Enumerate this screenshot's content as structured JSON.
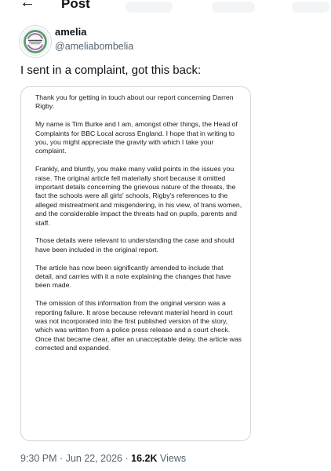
{
  "header": {
    "back_icon": "back-arrow-icon",
    "title": "Post"
  },
  "author": {
    "display_name": "amelia",
    "handle": "@ameliabombelia",
    "avatar_icon": "badge-logo-icon"
  },
  "tweet": {
    "text": "I sent in a complaint, got this back:"
  },
  "letter": {
    "paragraphs": [
      "Thank you for getting in touch about our report concerning Darren Rigby.",
      "My name is Tim Burke and I am, amongst other things, the Head of Complaints for BBC Local across England. I hope that in writing to you, you might appreciate the gravity with which I take your complaint.",
      "Frankly, and bluntly, you make many valid points in the issues you raise. The original article fell materially short because it omitted important details concerning the grievous nature of the threats, the fact the schools were all girls' schools, Rigby's references to the alleged mistreatment and misgendering, in his view, of trans women, and the considerable impact the threats had on pupils, parents and staff.",
      "Those details were relevant to understanding the case and should have been included in the original report.",
      "The article has now been significantly amended to include that detail, and carries with it a note explaining the changes that have been made.",
      "The omission of this information from the original version was a reporting failure. It arose because relevant material heard in court was not incorporated into the first published version of the story, which was written from a police press release and a court check. Once that became clear, after an unacceptable delay, the article was corrected and expanded."
    ]
  },
  "meta": {
    "time": "9:30 PM",
    "separator": "·",
    "date": "Jun 22, 2026",
    "views_count": "16.2K",
    "views_label": "Views"
  }
}
